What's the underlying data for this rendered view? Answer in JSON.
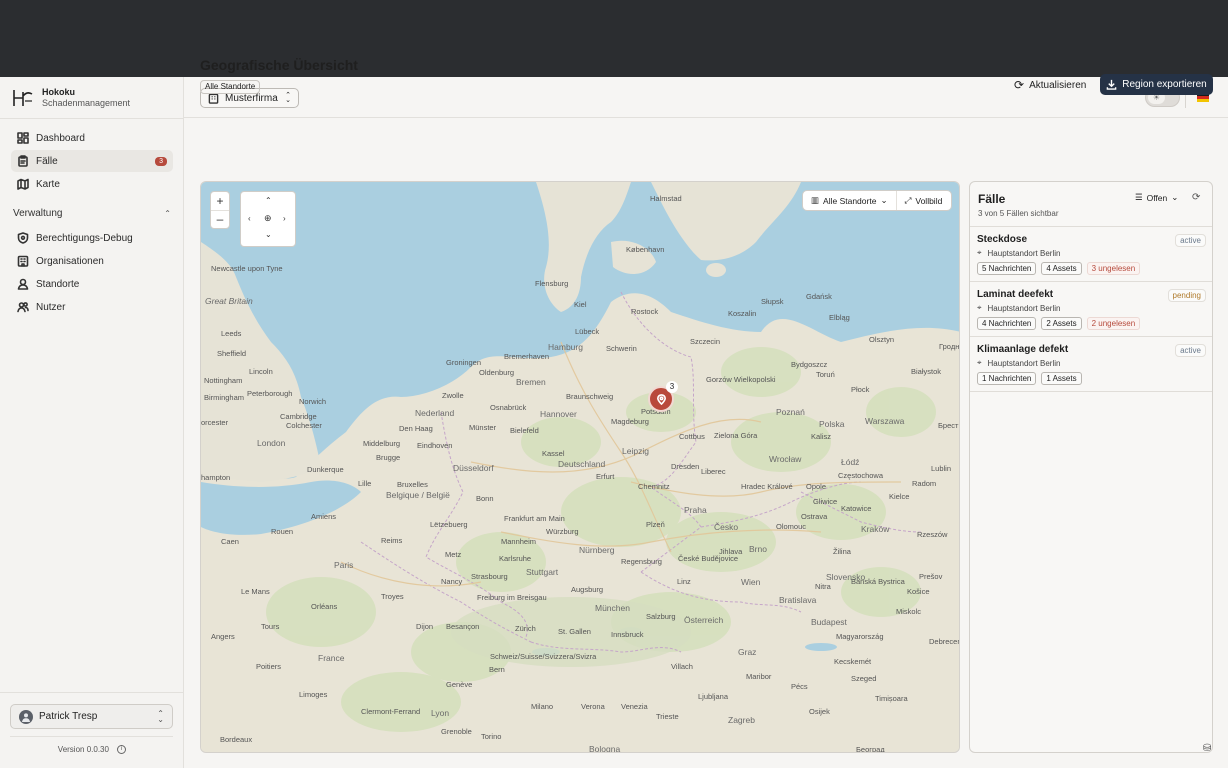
{
  "brand": {
    "name": "Hokoku",
    "subtitle": "Schadenmanagement"
  },
  "sidebar": {
    "items": [
      {
        "label": "Dashboard",
        "icon": "dashboard-icon"
      },
      {
        "label": "Fälle",
        "icon": "clipboard-icon",
        "badge": "3",
        "active": true
      },
      {
        "label": "Karte",
        "icon": "map-icon"
      }
    ],
    "section": {
      "label": "Verwaltung",
      "expanded": true
    },
    "admin_items": [
      {
        "label": "Berechtigungs-Debug",
        "icon": "shield-icon"
      },
      {
        "label": "Organisationen",
        "icon": "building-icon"
      },
      {
        "label": "Standorte",
        "icon": "location-user-icon"
      },
      {
        "label": "Nutzer",
        "icon": "users-icon"
      }
    ],
    "user": {
      "name": "Patrick Tresp"
    },
    "version": "Version 0.0.30"
  },
  "header": {
    "org": "Musterfirma",
    "theme": "light",
    "language": "de"
  },
  "page": {
    "title": "Geografische Übersicht",
    "scope_badge": "Alle Standorte",
    "refresh_label": "Aktualisieren",
    "export_label": "Region exportieren"
  },
  "map": {
    "filter_label": "Alle Standorte",
    "fullscreen_label": "Vollbild",
    "cluster_count": "3",
    "labels": {
      "haimstad": "Halmstad",
      "kobenhavn": "København",
      "great_britain": "Great Britain",
      "newcastle": "Newcastle upon Tyne",
      "leeds": "Leeds",
      "sheffield": "Sheffield",
      "nottingham": "Nottingham",
      "lincoln": "Lincoln",
      "peterborough": "Peterborough",
      "norwich": "Norwich",
      "birmingham": "Birmingham",
      "cambridge": "Cambridge",
      "colchester": "Colchester",
      "london": "London",
      "worcester": "orcester",
      "dunkerque": "Dunkerque",
      "hampton": "hampton",
      "lille": "Lille",
      "belgique": "Belgique / België",
      "bruxelles": "Bruxelles",
      "groningen": "Groningen",
      "oldenburg": "Oldenburg",
      "bremen": "Bremen",
      "hamburg": "Hamburg",
      "flensburg": "Flensburg",
      "kiel": "Kiel",
      "lubeck": "Lübeck",
      "schwerin": "Schwerin",
      "bremerhaven": "Bremerhaven",
      "zwolle": "Zwolle",
      "nederland": "Nederland",
      "den_haag": "Den Haag",
      "eindhoven": "Eindhoven",
      "middelburg": "Middelburg",
      "brugge": "Brugge",
      "osnabrueck": "Osnabrück",
      "muenster": "Münster",
      "bielefeld": "Bielefeld",
      "hannover": "Hannover",
      "duesseldorf": "Düsseldorf",
      "bonn": "Bonn",
      "kassel": "Kassel",
      "deutschland": "Deutschland",
      "leipzig": "Leipzig",
      "potsdam": "Potsdam",
      "chemnitz": "Chemnitz",
      "frankfurt": "Frankfurt am Main",
      "luxembourg": "Lëtzebuerg",
      "metz": "Metz",
      "paris": "Paris",
      "reims": "Reims",
      "nuernberg": "Nürnberg",
      "stuttgart": "Stuttgart",
      "augsburg": "Augsburg",
      "muenchen": "München",
      "freiburg": "Freiburg im Breisgau",
      "zuerich": "Zürich",
      "schweiz": "Schweiz/Suisse/Svizzera/Svizra",
      "bern": "Bern",
      "st_gallen": "St. Gallen",
      "france": "France",
      "limoges": "Limoges",
      "lyon": "Lyon",
      "bordeaux": "Bordeaux",
      "bologna": "Bologna",
      "innsbruck": "Innsbruck",
      "oesterreich": "Österreich",
      "wien": "Wien",
      "praha": "Praha",
      "cesko": "Česko",
      "brno": "Brno",
      "olomouc": "Olomouc",
      "jihlava": "Jihlava",
      "plzen": "Plzeň",
      "ceske_budejovice": "České Budějovice",
      "linz": "Linz",
      "graz": "Graz",
      "bratislava": "Bratislava",
      "slovensko": "Slovensko",
      "budapest": "Budapest",
      "magyarorszag": "Magyarország",
      "zagreb": "Zagreb",
      "ljubljana": "Ljubljana",
      "polska": "Polska",
      "warszawa": "Warszawa",
      "lodz": "Łódź",
      "poznan": "Poznań",
      "gorzow": "Gorzów Wielkopolski",
      "zielona": "Zielona Góra",
      "wroclaw": "Wrocław",
      "krakow": "Kraków",
      "katowice": "Katowice",
      "kielce": "Kielce",
      "czestochowa": "Częstochowa",
      "plock": "Płock",
      "elblag": "Elbląg",
      "slupsk": "Słupsk",
      "koszalin": "Koszalin",
      "szczecin": "Szczecin",
      "gdansk": "Gdańsk",
      "radom": "Radom",
      "kosice": "Košice",
      "miskolc": "Miskolc",
      "debrecen": "Debrecen",
      "szeged": "Szeged",
      "kecskemet": "Kecskemét",
      "timisoara": "Timișoara",
      "beograd": "Београд",
      "osijek": "Osijek",
      "pecs": "Pécs",
      "presov": "Prešov",
      "zilina": "Žilina",
      "rzeszow": "Rzeszów",
      "banska": "Banská Bystrica",
      "nitra": "Nitra",
      "brest": "Брест",
      "grodno": "Гродно",
      "lublin": "Lublin",
      "bialystok": "Białystok",
      "olsztyn": "Olsztyn",
      "bydgoszcz": "Bydgoszcz",
      "torun": "Toruń",
      "kalisz": "Kalisz",
      "opole": "Opole",
      "gliwice": "Gliwice",
      "hradec": "Hradec Králové",
      "liberec": "Liberec",
      "ostrava": "Ostrava",
      "regensburg": "Regensburg",
      "wurzburg": "Würzburg",
      "erfurt": "Erfurt",
      "magdeburg": "Magdeburg",
      "braunschweig": "Braunschweig",
      "rostock": "Rostock",
      "cottbus": "Cottbus",
      "dresden": "Dresden",
      "mannheim": "Mannheim",
      "karlsruhe": "Karlsruhe",
      "strasbourg": "Strasbourg",
      "dijon": "Dijon",
      "besancon": "Besançon",
      "nancy": "Nancy",
      "troyes": "Troyes",
      "orleans": "Orléans",
      "tours": "Tours",
      "le_mans": "Le Mans",
      "rouen": "Rouen",
      "caen": "Caen",
      "amiens": "Amiens",
      "salzburg": "Salzburg",
      "villach": "Villach",
      "maribor": "Maribor",
      "trieste": "Trieste",
      "venezia": "Venezia",
      "verona": "Verona",
      "milano": "Milano",
      "torino": "Torino",
      "geneve": "Genève",
      "grenoble": "Grenoble",
      "clermont": "Clermont-Ferrand",
      "poitiers": "Poitiers",
      "angers": "Angers"
    }
  },
  "cases": {
    "title": "Fälle",
    "subtitle": "3 von 5 Fällen sichtbar",
    "filter_label": "Offen",
    "items": [
      {
        "title": "Steckdose",
        "status": "active",
        "location": "Hauptstandort Berlin",
        "messages": "5 Nachrichten",
        "assets": "4 Assets",
        "unread": "3 ungelesen"
      },
      {
        "title": "Laminat deefekt",
        "status": "pending",
        "location": "Hauptstandort Berlin",
        "messages": "4 Nachrichten",
        "assets": "2 Assets",
        "unread": "2 ungelesen"
      },
      {
        "title": "Klimaanlage defekt",
        "status": "active",
        "location": "Hauptstandort Berlin",
        "messages": "1 Nachrichten",
        "assets": "1 Assets",
        "unread": ""
      }
    ]
  },
  "colors": {
    "accent": "#253246",
    "badge": "#b64a3c",
    "sea": "#aacfe0",
    "land": "#e6e3d6",
    "forest": "#cfdcb4",
    "status_active": "#6b7a8c",
    "status_pending": "#b07b2c"
  }
}
